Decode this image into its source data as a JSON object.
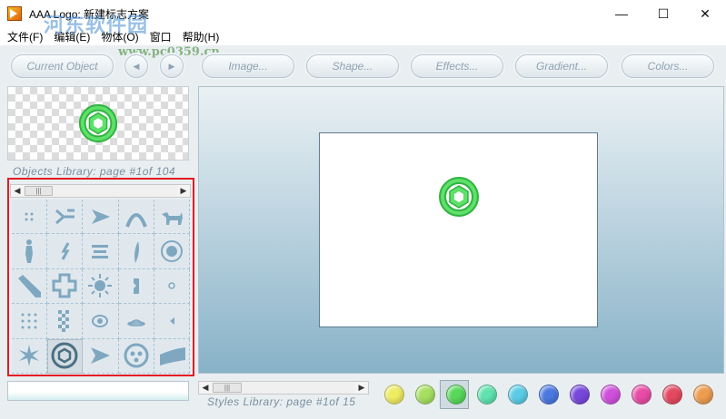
{
  "window": {
    "title": "AAA Logo: 新建标志方案",
    "watermark": "河东软件园",
    "watermark_url": "www.pc0359.cn",
    "controls": {
      "minimize": "—",
      "maximize": "☐",
      "close": "✕"
    }
  },
  "menu": {
    "items": [
      "文件(F)",
      "编辑(E)",
      "物体(O)",
      "窗口",
      "帮助(H)"
    ]
  },
  "toolbar": {
    "current_object": "Current Object",
    "prev": "◀",
    "next": "▶",
    "image": "Image...",
    "shape": "Shape...",
    "effects": "Effects...",
    "gradient": "Gradient...",
    "colors": "Colors..."
  },
  "objects_library": {
    "caption": "Objects Library: page #1of 104",
    "scroll_left": "◀",
    "scroll_right": "▶",
    "thumb": "|||",
    "icons": [
      "dots-icon",
      "arrows-icon",
      "arrow-right-icon",
      "arch-icon",
      "dog-icon",
      "person-icon",
      "slash-icon",
      "lines-icon",
      "blade-icon",
      "circle-target-icon",
      "pencil-icon",
      "plus-frame-icon",
      "burst-icon",
      "rune-icon",
      "small-circle-icon",
      "dot-grid-icon",
      "checker-icon",
      "eye-icon",
      "ufo-icon",
      "triangle-left-icon",
      "star-icon",
      "hexagon-ring-icon",
      "arrowhead-icon",
      "button-icon",
      "ribbon-icon"
    ],
    "selected_index": 21
  },
  "styles_library": {
    "caption": "Styles Library: page #1of 15",
    "scroll_left": "◀",
    "scroll_right": "▶",
    "thumb": "|||"
  },
  "swatches": [
    "#eeec60",
    "#a6e060",
    "#58d85a",
    "#60e2ae",
    "#5ccce6",
    "#4c78e0",
    "#7848dc",
    "#d050dc",
    "#e84ca6",
    "#e44860",
    "#ee9c50"
  ],
  "selected_swatch": 2,
  "colors": {
    "accent_green": "#3fd14f",
    "highlight_red": "#e31b23"
  }
}
